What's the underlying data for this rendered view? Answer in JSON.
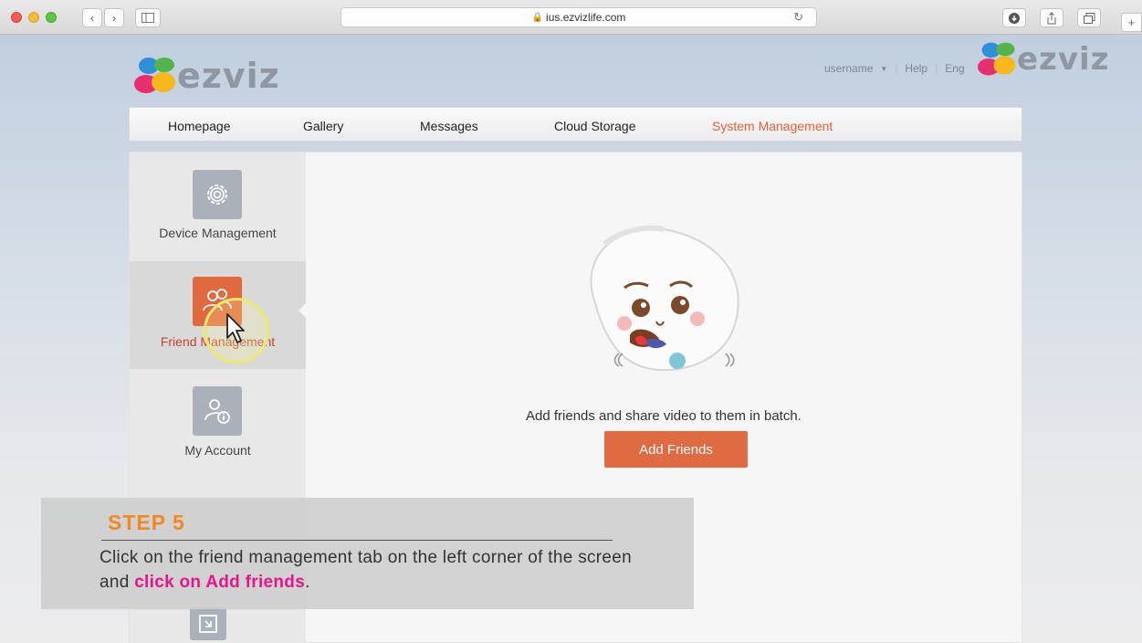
{
  "browser": {
    "url": "ius.ezvizlife.com",
    "back_icon": "chevron-left-icon",
    "forward_icon": "chevron-right-icon"
  },
  "site": {
    "logo_text": "ezviz",
    "watermark_logo_text": "ezviz",
    "top_links": {
      "user": "username",
      "help": "Help",
      "language": "Eng"
    }
  },
  "nav": {
    "items": [
      "Homepage",
      "Gallery",
      "Messages",
      "Cloud Storage",
      "System Management"
    ],
    "active": "System Management",
    "accent_color": "#e2623a"
  },
  "sidebar": {
    "items": [
      {
        "label": "Device Management",
        "icon": "gear-icon"
      },
      {
        "label": "Friend Management",
        "icon": "friends-icon"
      },
      {
        "label": "My Account",
        "icon": "account-info-icon"
      }
    ],
    "active": "Friend Management"
  },
  "main": {
    "empty_message": "Add friends and share video to them in batch.",
    "add_button": "Add Friends"
  },
  "overlay": {
    "title": "STEP 5",
    "text_plain": "Click on the friend management tab on the left corner of the screen and ",
    "text_highlight": "click on Add friends",
    "text_end": ".",
    "title_color": "#f0891f",
    "highlight_color": "#e4168a"
  }
}
